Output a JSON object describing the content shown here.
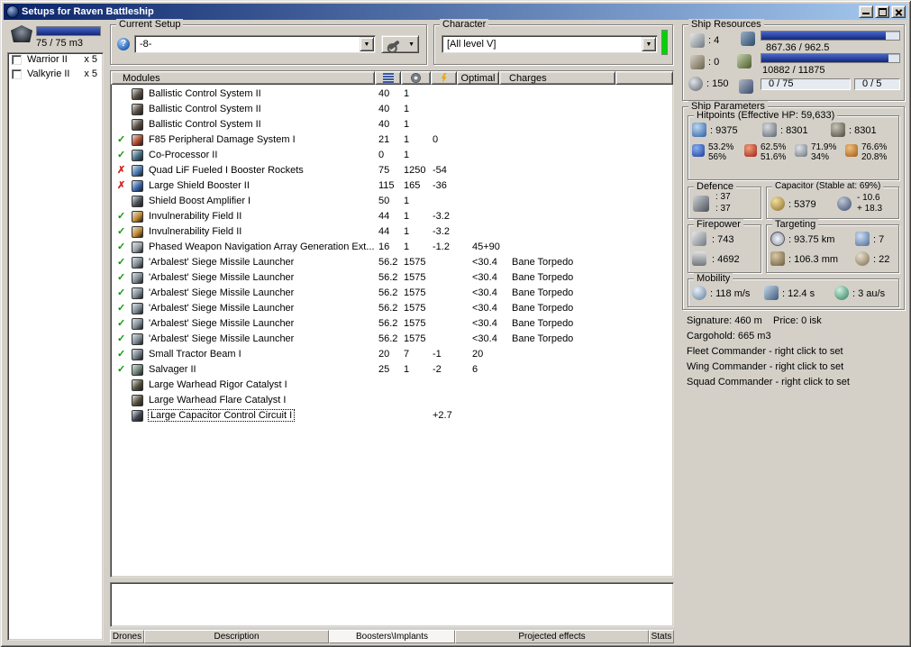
{
  "window": {
    "title": "Setups for Raven Battleship"
  },
  "glyphs": {
    "ok": "✓",
    "bad": "✗",
    "dropdown": "▼",
    "help": "?"
  },
  "left_panel": {
    "capacity_text": "75 / 75 m3",
    "capacity_pct": 100,
    "drones": [
      {
        "name": "Warrior II",
        "qty": "x 5"
      },
      {
        "name": "Valkyrie II",
        "qty": "x 5"
      }
    ]
  },
  "setup_group": {
    "label": "Current Setup",
    "value": "-8-"
  },
  "character_group": {
    "label": "Character",
    "value": "[All level V]"
  },
  "modules": {
    "header": "Modules",
    "col_optimal": "Optimal",
    "col_charges": "Charges",
    "rows": [
      {
        "st": "",
        "icon": "ballistic-control-module-icon",
        "color": "#5a4f42",
        "name": "Ballistic Control System II",
        "a": "40",
        "b": "1"
      },
      {
        "st": "",
        "icon": "ballistic-control-module-icon",
        "color": "#5a4f42",
        "name": "Ballistic Control System II",
        "a": "40",
        "b": "1"
      },
      {
        "st": "",
        "icon": "ballistic-control-module-icon",
        "color": "#5a4f42",
        "name": "Ballistic Control System II",
        "a": "40",
        "b": "1"
      },
      {
        "st": "ok",
        "icon": "damage-system-module-icon",
        "color": "#b24a28",
        "name": "F85 Peripheral Damage System I",
        "a": "21",
        "b": "1",
        "c": "0"
      },
      {
        "st": "ok",
        "icon": "co-processor-module-icon",
        "color": "#3f7085",
        "name": "Co-Processor II",
        "a": "0",
        "b": "1"
      },
      {
        "st": "bad",
        "icon": "booster-rockets-module-icon",
        "color": "#4a7ab5",
        "name": "Quad LiF Fueled I Booster Rockets",
        "a": "75",
        "b": "1250",
        "c": "-54"
      },
      {
        "st": "bad",
        "icon": "shield-booster-module-icon",
        "color": "#3a66b0",
        "name": "Large Shield Booster II",
        "a": "115",
        "b": "165",
        "c": "-36"
      },
      {
        "st": "",
        "icon": "boost-amplifier-module-icon",
        "color": "#4a4f58",
        "name": "Shield Boost Amplifier I",
        "a": "50",
        "b": "1"
      },
      {
        "st": "ok",
        "icon": "invulnerability-field-module-icon",
        "color": "#c28a30",
        "name": "Invulnerability Field II",
        "a": "44",
        "b": "1",
        "c": "-3.2"
      },
      {
        "st": "ok",
        "icon": "invulnerability-field-module-icon",
        "color": "#c28a30",
        "name": "Invulnerability Field II",
        "a": "44",
        "b": "1",
        "c": "-3.2"
      },
      {
        "st": "ok",
        "icon": "target-painter-module-icon",
        "color": "#98a2ac",
        "name": "Phased Weapon Navigation Array Generation Ext...",
        "a": "16",
        "b": "1",
        "c": "-1.2",
        "opt": "45+90"
      },
      {
        "st": "ok",
        "icon": "missile-launcher-module-icon",
        "color": "#7e8c96",
        "name": "'Arbalest' Siege Missile Launcher",
        "a": "56.2",
        "b": "1575",
        "opt": "<30.4",
        "chg": "Bane Torpedo"
      },
      {
        "st": "ok",
        "icon": "missile-launcher-module-icon",
        "color": "#7e8c96",
        "name": "'Arbalest' Siege Missile Launcher",
        "a": "56.2",
        "b": "1575",
        "opt": "<30.4",
        "chg": "Bane Torpedo"
      },
      {
        "st": "ok",
        "icon": "missile-launcher-module-icon",
        "color": "#7e8c96",
        "name": "'Arbalest' Siege Missile Launcher",
        "a": "56.2",
        "b": "1575",
        "opt": "<30.4",
        "chg": "Bane Torpedo"
      },
      {
        "st": "ok",
        "icon": "missile-launcher-module-icon",
        "color": "#7e8c96",
        "name": "'Arbalest' Siege Missile Launcher",
        "a": "56.2",
        "b": "1575",
        "opt": "<30.4",
        "chg": "Bane Torpedo"
      },
      {
        "st": "ok",
        "icon": "missile-launcher-module-icon",
        "color": "#7e8c96",
        "name": "'Arbalest' Siege Missile Launcher",
        "a": "56.2",
        "b": "1575",
        "opt": "<30.4",
        "chg": "Bane Torpedo"
      },
      {
        "st": "ok",
        "icon": "missile-launcher-module-icon",
        "color": "#7e8c96",
        "name": "'Arbalest' Siege Missile Launcher",
        "a": "56.2",
        "b": "1575",
        "opt": "<30.4",
        "chg": "Bane Torpedo"
      },
      {
        "st": "ok",
        "icon": "tractor-beam-module-icon",
        "color": "#6f7d88",
        "name": "Small Tractor Beam I",
        "a": "20",
        "b": "7",
        "c": "-1",
        "opt": "20"
      },
      {
        "st": "ok",
        "icon": "salvager-module-icon",
        "color": "#6f8578",
        "name": "Salvager II",
        "a": "25",
        "b": "1",
        "c": "-2",
        "opt": "6"
      },
      {
        "st": "",
        "icon": "rig-module-icon",
        "color": "#55503a",
        "name": "Large Warhead Rigor Catalyst I"
      },
      {
        "st": "",
        "icon": "rig-module-icon",
        "color": "#55503a",
        "name": "Large Warhead Flare Catalyst I"
      },
      {
        "st": "",
        "icon": "capacitor-rig-module-icon",
        "color": "#3f4450",
        "name": "Large Capacitor Control Circuit I",
        "c": "+2.7",
        "sel": true
      }
    ]
  },
  "tabs": [
    {
      "label": "Drones",
      "active": false
    },
    {
      "label": "Description",
      "active": false
    },
    {
      "label": "Boosters\\Implants",
      "active": true
    },
    {
      "label": "Projected effects",
      "active": false
    },
    {
      "label": "Stats",
      "active": false
    }
  ],
  "ship_resources": {
    "label": "Ship Resources",
    "turrets": ": 4",
    "launchers": ": 0",
    "calibration": ": 150",
    "cpu_text": "867.36 / 962.5",
    "cpu_pct": 90,
    "power_text": "10882 / 11875",
    "power_pct": 92,
    "drone_bandwidth": "0 / 75",
    "drone_count": "0 / 5"
  },
  "ship_parameters": {
    "label": "Ship Parameters",
    "hitpoints": {
      "label": "Hitpoints (Effective HP: 59,633)",
      "shield": ": 9375",
      "armor": ": 8301",
      "structure": ": 8301",
      "resists": [
        {
          "name": "em",
          "top": "53.2%",
          "bottom": "56%"
        },
        {
          "name": "thermal",
          "top": "62.5%",
          "bottom": "51.6%"
        },
        {
          "name": "kinetic",
          "top": "71.9%",
          "bottom": "34%"
        },
        {
          "name": "explosive",
          "top": "76.6%",
          "bottom": "20.8%"
        }
      ]
    },
    "defence": {
      "label": "Defence",
      "value1": ": 37",
      "value2": ": 37"
    },
    "capacitor": {
      "label": "Capacitor (Stable at: 69%)",
      "amount": ": 5379",
      "drain": "- 10.6",
      "recharge": "+ 18.3"
    },
    "firepower": {
      "label": "Firepower",
      "turret": ": 743",
      "missile": ": 4692"
    },
    "targeting": {
      "label": "Targeting",
      "range": ": 93.75 km",
      "max_targets": ": 7",
      "scan_resolution": ": 106.3 mm",
      "sensor_strength": ": 22"
    },
    "mobility": {
      "label": "Mobility",
      "speed": ": 118 m/s",
      "align": ": 12.4 s",
      "warp": ": 3 au/s"
    },
    "lines": {
      "signature": "Signature: 460 m",
      "price": "Price: 0 isk",
      "cargohold": "Cargohold: 665 m3",
      "fleet": "Fleet Commander - right click to set",
      "wing": "Wing Commander - right click to set",
      "squad": "Squad Commander - right click to set"
    }
  }
}
